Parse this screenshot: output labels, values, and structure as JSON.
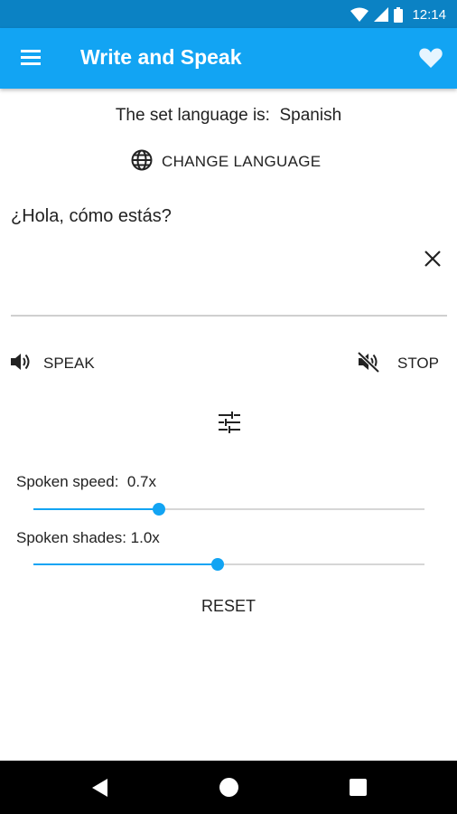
{
  "status_bar": {
    "time": "12:14",
    "icons": [
      "wifi-icon",
      "cellular-signal-icon",
      "battery-icon"
    ]
  },
  "app_bar": {
    "title": "Write and Speak",
    "menu_icon": "hamburger-menu-icon",
    "favorite_icon": "heart-icon"
  },
  "language": {
    "prefix": "The set language is:  ",
    "current": "Spanish",
    "change_label": "CHANGE LANGUAGE",
    "change_icon": "globe-icon"
  },
  "text_field": {
    "value": "¿Hola, cómo estás?",
    "clear_icon": "close-icon"
  },
  "speech_controls": {
    "speak_label": "SPEAK",
    "speak_icon": "volume-up-icon",
    "stop_label": "STOP",
    "stop_icon": "volume-off-icon"
  },
  "settings_icon": "tune-icon",
  "sliders": {
    "speed": {
      "label": "Spoken speed:  0.7x",
      "value": 0.7,
      "fill_fraction": 0.32
    },
    "shades": {
      "label": "Spoken shades: 1.0x",
      "value": 1.0,
      "fill_fraction": 0.47
    }
  },
  "reset_label": "RESET",
  "nav_bar": {
    "back_icon": "back-triangle-icon",
    "home_icon": "home-circle-icon",
    "recents_icon": "recents-square-icon"
  },
  "colors": {
    "status_bar": "#0b82c4",
    "app_bar": "#12a4f3",
    "accent": "#12a4f3"
  }
}
